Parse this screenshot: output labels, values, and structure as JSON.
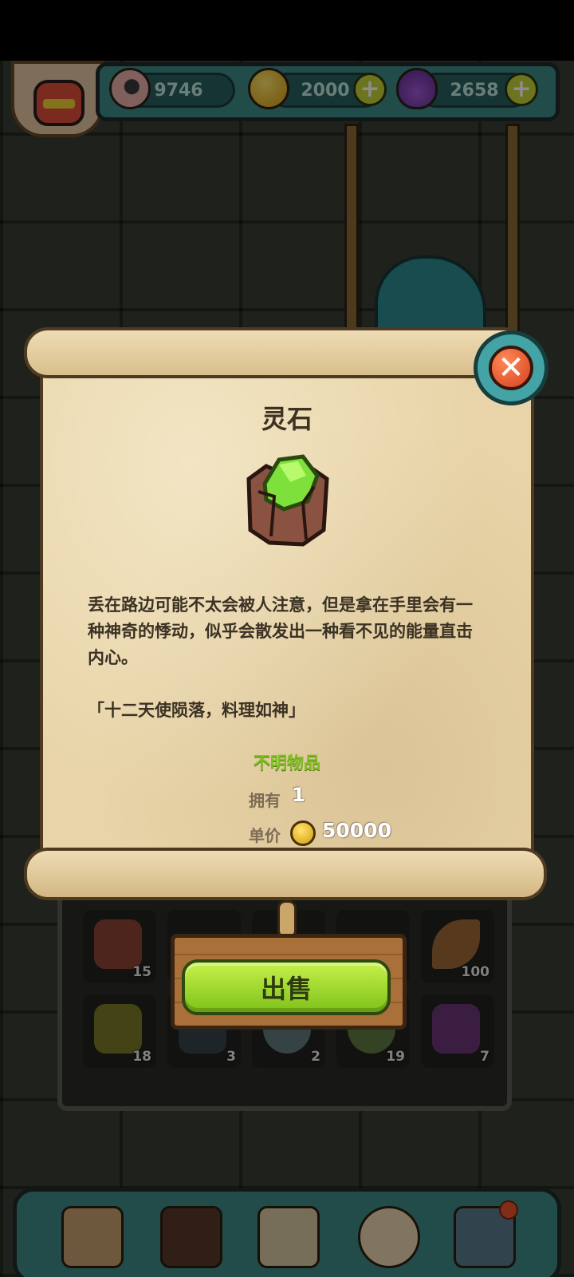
{
  "resources": {
    "eyes": "9746",
    "coins": "2000",
    "potions": "2658"
  },
  "item": {
    "title": "灵石",
    "description": "丢在路边可能不太会被人注意，但是拿在手里会有一种神奇的悸动，似乎会散发出一种看不见的能量直击内心。",
    "quote": "「十二天使陨落，料理如神」",
    "category": "不明物品",
    "owned_label": "拥有",
    "owned_value": "1",
    "price_label": "单价",
    "price_value": "50000"
  },
  "actions": {
    "sell_label": "出售",
    "close_icon": "close-icon"
  },
  "inventory": {
    "slots": [
      {
        "count": "15"
      },
      {
        "count": ""
      },
      {
        "count": ""
      },
      {
        "count": ""
      },
      {
        "count": "100"
      },
      {
        "count": "18"
      },
      {
        "count": "3"
      },
      {
        "count": "2"
      },
      {
        "count": "19"
      },
      {
        "count": "7"
      }
    ]
  },
  "colors": {
    "accent_green": "#7fbf24",
    "teal_ui": "#3f8a86",
    "parchment": "#e8d4a8",
    "close_red": "#d4401f"
  }
}
